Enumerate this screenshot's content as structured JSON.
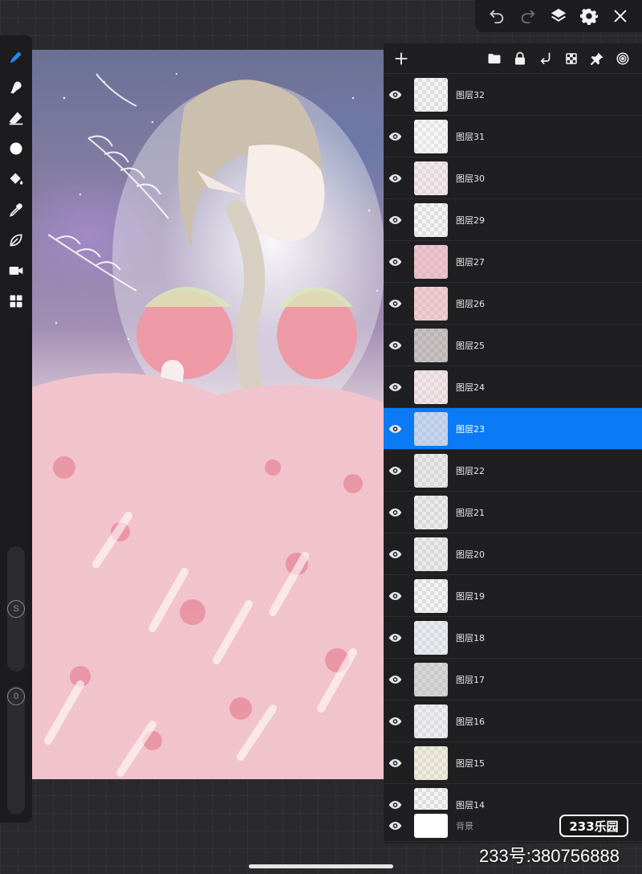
{
  "toolbar": {
    "undo_icon": "undo-icon",
    "redo_icon": "redo-icon",
    "layers_icon": "layers-icon",
    "settings_icon": "gear-icon",
    "close_icon": "close-icon"
  },
  "left_tools": {
    "tools": [
      "brush-icon",
      "smudge-icon",
      "eraser-icon",
      "color-dot-icon",
      "fill-bucket-icon",
      "eyedropper-icon",
      "leaf-icon",
      "video-icon",
      "grid-icon"
    ],
    "size_slider_label": "S",
    "opacity_slider_label": "0"
  },
  "layers_panel": {
    "header_icons": [
      "folder-icon",
      "lock-icon",
      "merge-down-icon",
      "checker-icon",
      "pin-icon",
      "target-icon"
    ],
    "layers": [
      {
        "name": "图层32",
        "selected": false
      },
      {
        "name": "图层31",
        "selected": false
      },
      {
        "name": "图层30",
        "selected": false
      },
      {
        "name": "图层29",
        "selected": false
      },
      {
        "name": "图层27",
        "selected": false
      },
      {
        "name": "图层26",
        "selected": false
      },
      {
        "name": "图层25",
        "selected": false
      },
      {
        "name": "图层24",
        "selected": false
      },
      {
        "name": "图层23",
        "selected": true
      },
      {
        "name": "图层22",
        "selected": false
      },
      {
        "name": "图层21",
        "selected": false
      },
      {
        "name": "图层20",
        "selected": false
      },
      {
        "name": "图层19",
        "selected": false
      },
      {
        "name": "图层18",
        "selected": false
      },
      {
        "name": "图层17",
        "selected": false
      },
      {
        "name": "图层16",
        "selected": false
      },
      {
        "name": "图层15",
        "selected": false
      },
      {
        "name": "图层14",
        "selected": false
      }
    ],
    "background_layer": "背景"
  },
  "watermark": {
    "logo": "233乐园",
    "id_text": "233号:380756888"
  },
  "colors": {
    "accent": "#0a7af5",
    "panel": "#1f1f21"
  }
}
